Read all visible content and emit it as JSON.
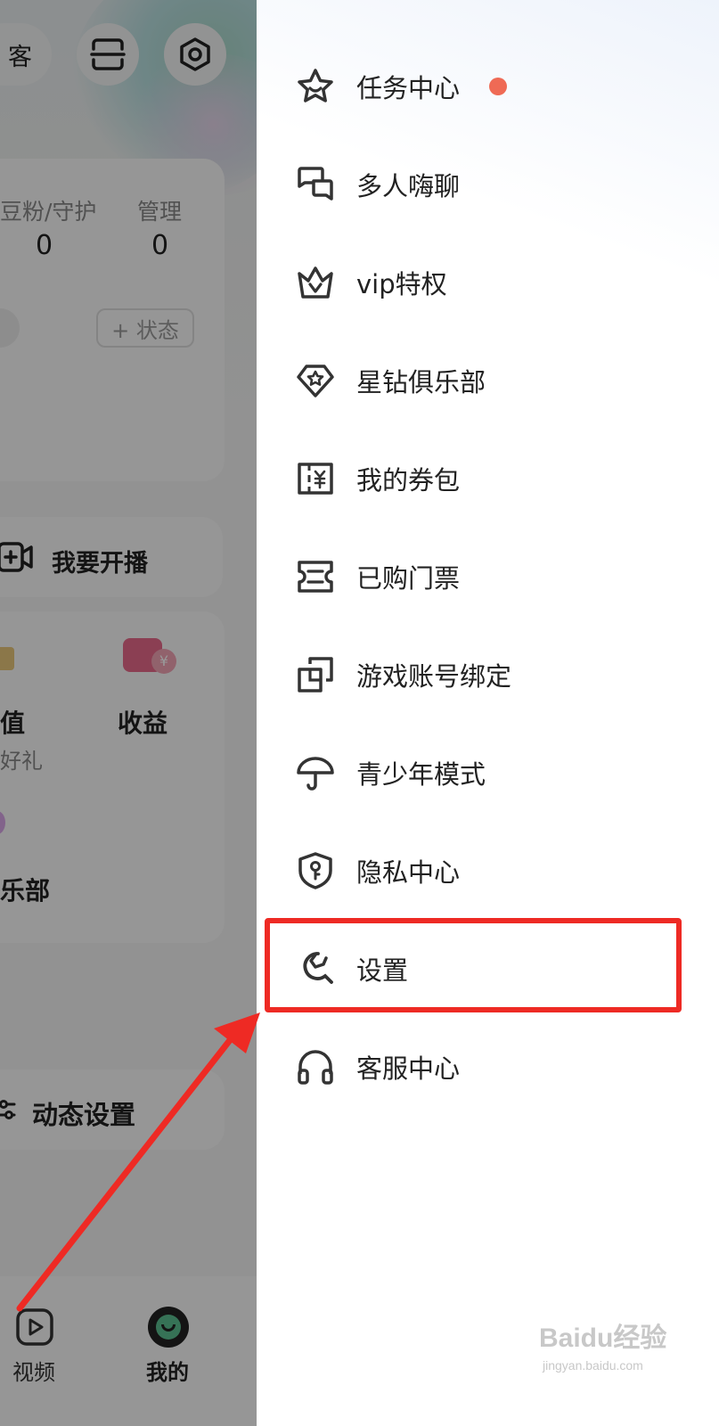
{
  "background_page": {
    "top_pill_label": "客",
    "stats": [
      {
        "label": "豆粉/守护",
        "value": "0"
      },
      {
        "label": "管理",
        "value": "0"
      }
    ],
    "status_button": "+ 状态",
    "start_live": "我要开播",
    "recharge_label": "值",
    "recharge_sub": "好礼",
    "earnings_label": "收益",
    "club_label": "乐部",
    "dynamic_settings": "动态设置",
    "nav": [
      {
        "label": "视频",
        "active": false
      },
      {
        "label": "我的",
        "active": true
      }
    ]
  },
  "drawer": {
    "items": [
      {
        "label": "任务中心",
        "icon": "star-icon",
        "has_dot": true
      },
      {
        "label": "多人嗨聊",
        "icon": "chat-bubbles-icon",
        "has_dot": false
      },
      {
        "label": "vip特权",
        "icon": "crown-icon",
        "has_dot": false
      },
      {
        "label": "星钻俱乐部",
        "icon": "diamond-icon",
        "has_dot": false
      },
      {
        "label": "我的券包",
        "icon": "coupon-icon",
        "has_dot": false
      },
      {
        "label": "已购门票",
        "icon": "ticket-icon",
        "has_dot": false
      },
      {
        "label": "游戏账号绑定",
        "icon": "link-icon",
        "has_dot": false
      },
      {
        "label": "青少年模式",
        "icon": "umbrella-icon",
        "has_dot": false
      },
      {
        "label": "隐私中心",
        "icon": "shield-key-icon",
        "has_dot": false
      },
      {
        "label": "设置",
        "icon": "wrench-icon",
        "has_dot": false,
        "highlighted": true
      },
      {
        "label": "客服中心",
        "icon": "headphones-icon",
        "has_dot": false
      }
    ]
  },
  "watermark": {
    "brand": "Baidu经验",
    "url": "jingyan.baidu.com"
  },
  "colors": {
    "highlight": "#ee2a24",
    "dot": "#ef6a55",
    "icon": "#333333"
  }
}
